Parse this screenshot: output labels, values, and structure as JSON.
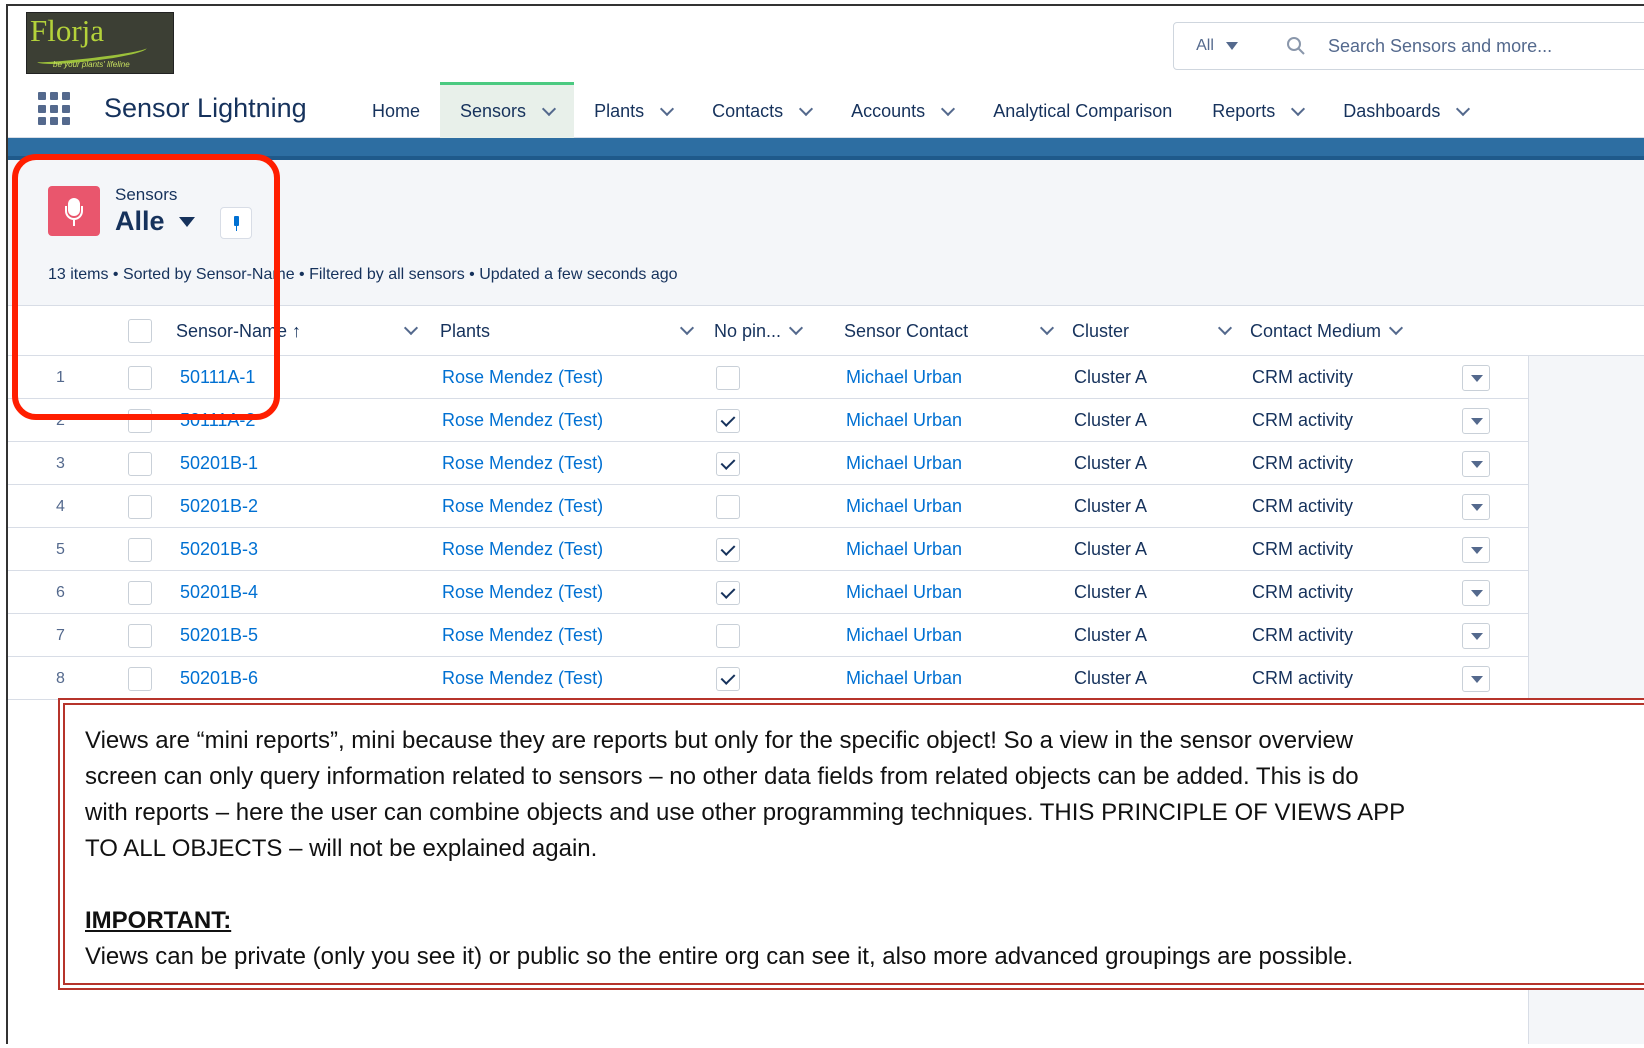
{
  "logo": {
    "brand": "Florja",
    "tagline": "be your plants' lifeline"
  },
  "search": {
    "scope": "All",
    "placeholder": "Search Sensors and more..."
  },
  "app": {
    "name": "Sensor Lightning"
  },
  "tabs": [
    {
      "label": "Home"
    },
    {
      "label": "Sensors"
    },
    {
      "label": "Plants"
    },
    {
      "label": "Contacts"
    },
    {
      "label": "Accounts"
    },
    {
      "label": "Analytical Comparison"
    },
    {
      "label": "Reports"
    },
    {
      "label": "Dashboards"
    }
  ],
  "list": {
    "object_label": "Sensors",
    "view_name": "Alle",
    "status": "13 items • Sorted by Sensor-Name • Filtered by all sensors • Updated a few seconds ago",
    "columns": [
      "Sensor-Name ↑",
      "Plants",
      "No pin...",
      "Sensor Contact",
      "Cluster",
      "Contact Medium"
    ],
    "rows": [
      {
        "num": "1",
        "name": "50111A-1",
        "plant": "Rose Mendez (Test)",
        "nopin": false,
        "contact": "Michael Urban",
        "cluster": "Cluster A",
        "medium": "CRM activity"
      },
      {
        "num": "2",
        "name": "50111A-2",
        "plant": "Rose Mendez (Test)",
        "nopin": true,
        "contact": "Michael Urban",
        "cluster": "Cluster A",
        "medium": "CRM activity"
      },
      {
        "num": "3",
        "name": "50201B-1",
        "plant": "Rose Mendez (Test)",
        "nopin": true,
        "contact": "Michael Urban",
        "cluster": "Cluster A",
        "medium": "CRM activity"
      },
      {
        "num": "4",
        "name": "50201B-2",
        "plant": "Rose Mendez (Test)",
        "nopin": false,
        "contact": "Michael Urban",
        "cluster": "Cluster A",
        "medium": "CRM activity"
      },
      {
        "num": "5",
        "name": "50201B-3",
        "plant": "Rose Mendez (Test)",
        "nopin": true,
        "contact": "Michael Urban",
        "cluster": "Cluster A",
        "medium": "CRM activity"
      },
      {
        "num": "6",
        "name": "50201B-4",
        "plant": "Rose Mendez (Test)",
        "nopin": true,
        "contact": "Michael Urban",
        "cluster": "Cluster A",
        "medium": "CRM activity"
      },
      {
        "num": "7",
        "name": "50201B-5",
        "plant": "Rose Mendez (Test)",
        "nopin": false,
        "contact": "Michael Urban",
        "cluster": "Cluster A",
        "medium": "CRM activity"
      },
      {
        "num": "8",
        "name": "50201B-6",
        "plant": "Rose Mendez (Test)",
        "nopin": true,
        "contact": "Michael Urban",
        "cluster": "Cluster A",
        "medium": "CRM activity"
      }
    ]
  },
  "callout": {
    "lines": [
      "Views are “mini reports”, mini because they are reports but only for the specific object! So a view in the sensor overview",
      " screen can only query information related to sensors – no other data fields from related objects can be added. This is do",
      "with reports – here the user can combine objects and use other programming techniques. THIS PRINCIPLE OF VIEWS APP",
      "TO ALL OBJECTS  – will not be explained again."
    ],
    "important_label": "IMPORTANT:",
    "important_text": "Views can be private (only you see it) or public so the entire org can see it, also more advanced groupings are possible."
  },
  "colors": {
    "accent_tab": "#4bca81",
    "link": "#0070d2",
    "object_icon": "#e9566d",
    "highlight": "#ff1e00",
    "callout_border": "#b6342b"
  }
}
